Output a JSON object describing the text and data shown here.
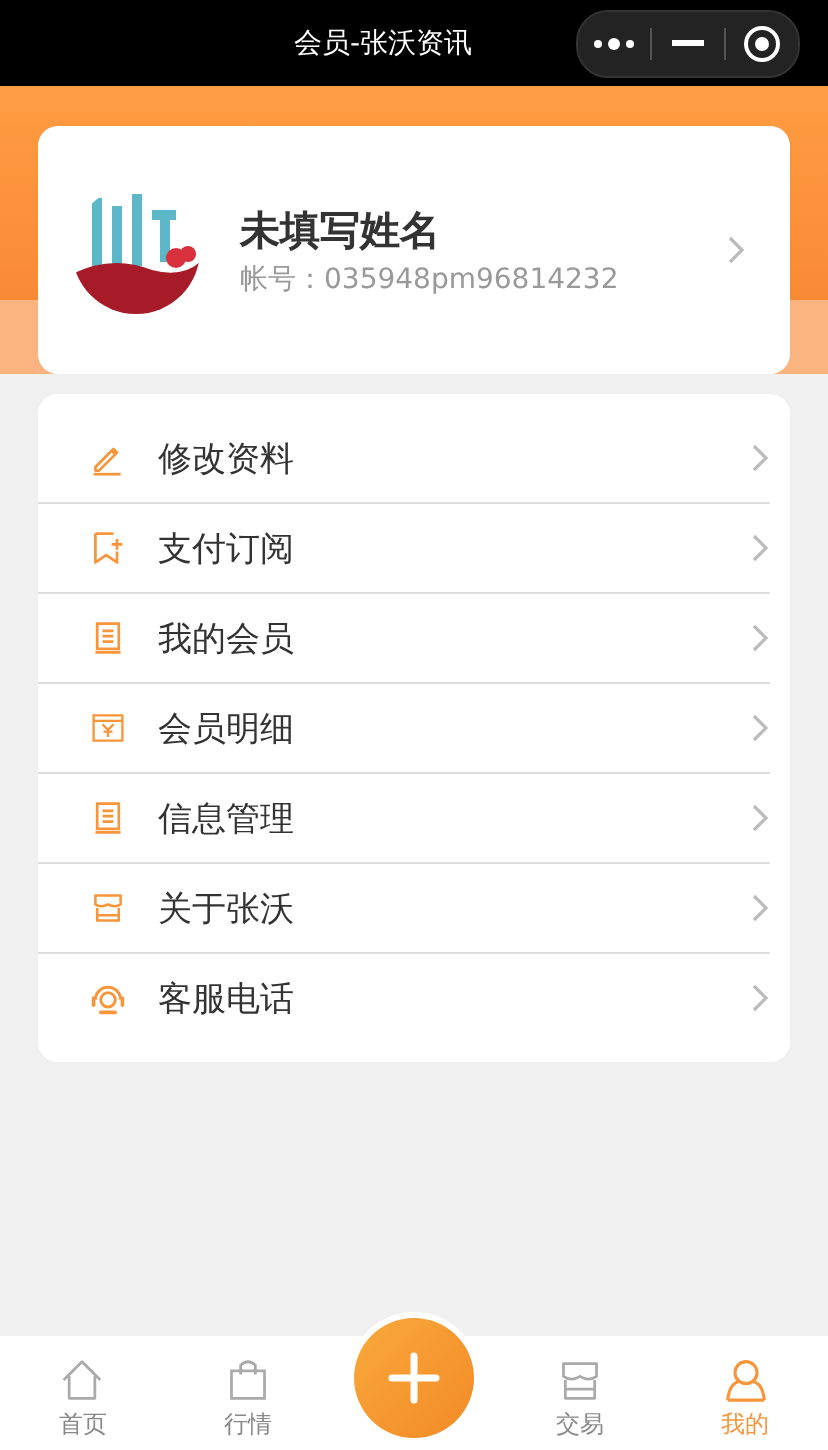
{
  "top_bar": {
    "title": "会员-张沃资讯"
  },
  "profile": {
    "name": "未填写姓名",
    "account": "帐号：035948pm96814232"
  },
  "menu": [
    {
      "kind": "edit",
      "label": "修改资料"
    },
    {
      "kind": "bookmark",
      "label": "支付订阅"
    },
    {
      "kind": "book",
      "label": "我的会员"
    },
    {
      "kind": "bill",
      "label": "会员明细"
    },
    {
      "kind": "book",
      "label": "信息管理"
    },
    {
      "kind": "shop",
      "label": "关于张沃"
    },
    {
      "kind": "headset",
      "label": "客服电话"
    }
  ],
  "tab_bar": [
    {
      "kind": "home",
      "label": "首页",
      "selected": false
    },
    {
      "kind": "bag",
      "label": "行情",
      "selected": false
    },
    {
      "kind": "plus",
      "selected": false
    },
    {
      "kind": "shop",
      "label": "交易",
      "selected": false
    },
    {
      "kind": "person",
      "label": "我的",
      "selected": true
    }
  ]
}
